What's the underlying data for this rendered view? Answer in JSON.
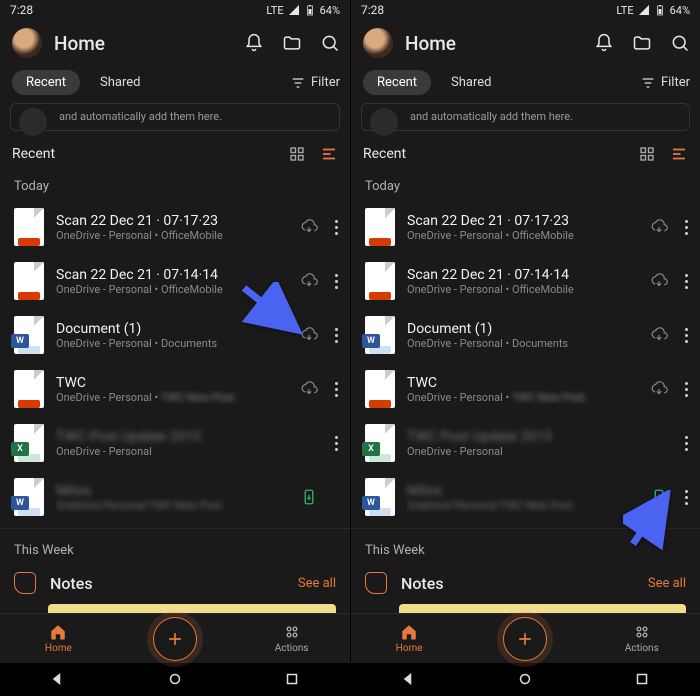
{
  "status": {
    "time": "7:28",
    "network": "LTE",
    "battery": "64%"
  },
  "header": {
    "title": "Home"
  },
  "tabs": {
    "recent": "Recent",
    "shared": "Shared"
  },
  "filter_label": "Filter",
  "banner_text": "and automatically add them here.",
  "section_recent": "Recent",
  "group_today": "Today",
  "files": [
    {
      "title": "Scan 22 Dec 21 · 07·17·23",
      "sub": "OneDrive - Personal • OfficeMobile",
      "type": "pdf",
      "action": "cloud"
    },
    {
      "title": "Scan 22 Dec 21 · 07·14·14",
      "sub": "OneDrive - Personal • OfficeMobile",
      "type": "pdf",
      "action": "cloud"
    },
    {
      "title": "Document (1)",
      "sub": "OneDrive - Personal • Documents",
      "type": "word",
      "action": "cloud"
    },
    {
      "title": "TWC",
      "sub": "OneDrive - Personal • ",
      "sub_blur": "TWC New Post",
      "type": "pdf",
      "action": "cloud"
    },
    {
      "title_blur": "TWC Post Update 2015",
      "sub": "OneDrive - Personal",
      "type": "excel",
      "action": "none"
    },
    {
      "title_blur": "Mitos",
      "sub_blur": "OneDrive Personal  TWC New Post",
      "type": "word",
      "action": "device"
    }
  ],
  "group_week": "This Week",
  "notes": {
    "title": "Notes",
    "see_all": "See all"
  },
  "nav": {
    "home": "Home",
    "actions": "Actions"
  },
  "colors": {
    "accent": "#e67a3c",
    "word": "#2b579a",
    "excel": "#217346",
    "pdf": "#d83b01",
    "device": "#2fb36a"
  }
}
